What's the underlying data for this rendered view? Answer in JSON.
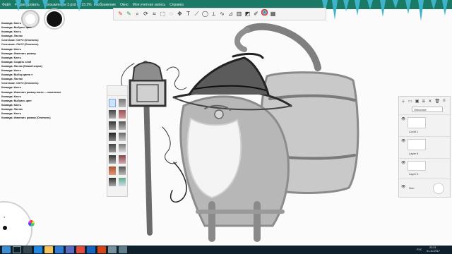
{
  "window": {
    "title": "Безымянное 3.psd @ 33.3%",
    "menu": [
      "Файл",
      "Редактировать",
      "Изображение",
      "Окно",
      "Моя учетная запись",
      "Справка"
    ]
  },
  "brush_puck": {
    "main_color": "#ffffff",
    "secondary_color": "#111111"
  },
  "toolbar": {
    "icons": [
      "red-brush-icon",
      "green-brush-icon",
      "zoom-icon",
      "rotate-icon",
      "crop-icon",
      "select-icon",
      "lasso-icon",
      "move-icon",
      "text-icon",
      "ruler-icon",
      "ellipse-icon",
      "symmetry-icon",
      "stroke-icon",
      "perspective-icon",
      "gradient-icon",
      "fill-icon",
      "brush-icon",
      "color-wheel-icon",
      "swatch-icon"
    ]
  },
  "shortcut_log": [
    "Команда: Кисть",
    "Команда: Выбрать цвет",
    "Команда: Кисть",
    "Команда: Ластик",
    "Сочетание: Ctrl+Z  (Отменить)",
    "Сочетание: Ctrl+Z  (Отменить)",
    "Команда: Кисть",
    "Команда: Изменить размер",
    "Команда: Кисть",
    "Команда: Создать слой",
    "Команда: Ластик  (Новый штрих)",
    "Команда: Кисть",
    "Команда: Выбор цвета ●",
    "Команда: Ластик",
    "Сочетание: Ctrl+Z  (Отменить)",
    "Команда: Кисть",
    "Команда: Изменить размер кисти  —  изменение",
    "Команда: Кисть",
    "Команда: Выбрать цвет",
    "Команда: Кисть",
    "Команда: Ластик",
    "Команда: Кисть",
    "Команда: Изменить размер  (Отменить)"
  ],
  "layers_panel": {
    "blend_mode": "Обычные",
    "layers": [
      {
        "name": "Слой 1"
      },
      {
        "name": "Layer 6"
      },
      {
        "name": "Layer 0"
      },
      {
        "name": "Фон"
      }
    ]
  },
  "taskbar": {
    "icons": [
      "windows-logo-icon",
      "search-icon",
      "task-view-icon",
      "edge-icon",
      "explorer-icon",
      "store-icon",
      "mail-icon",
      "chrome-icon",
      "photoshop-icon",
      "sketchbook-icon",
      "app-icon",
      "app-icon"
    ],
    "lang": "РУС",
    "time": "23:31",
    "date": "01.10.2017"
  }
}
